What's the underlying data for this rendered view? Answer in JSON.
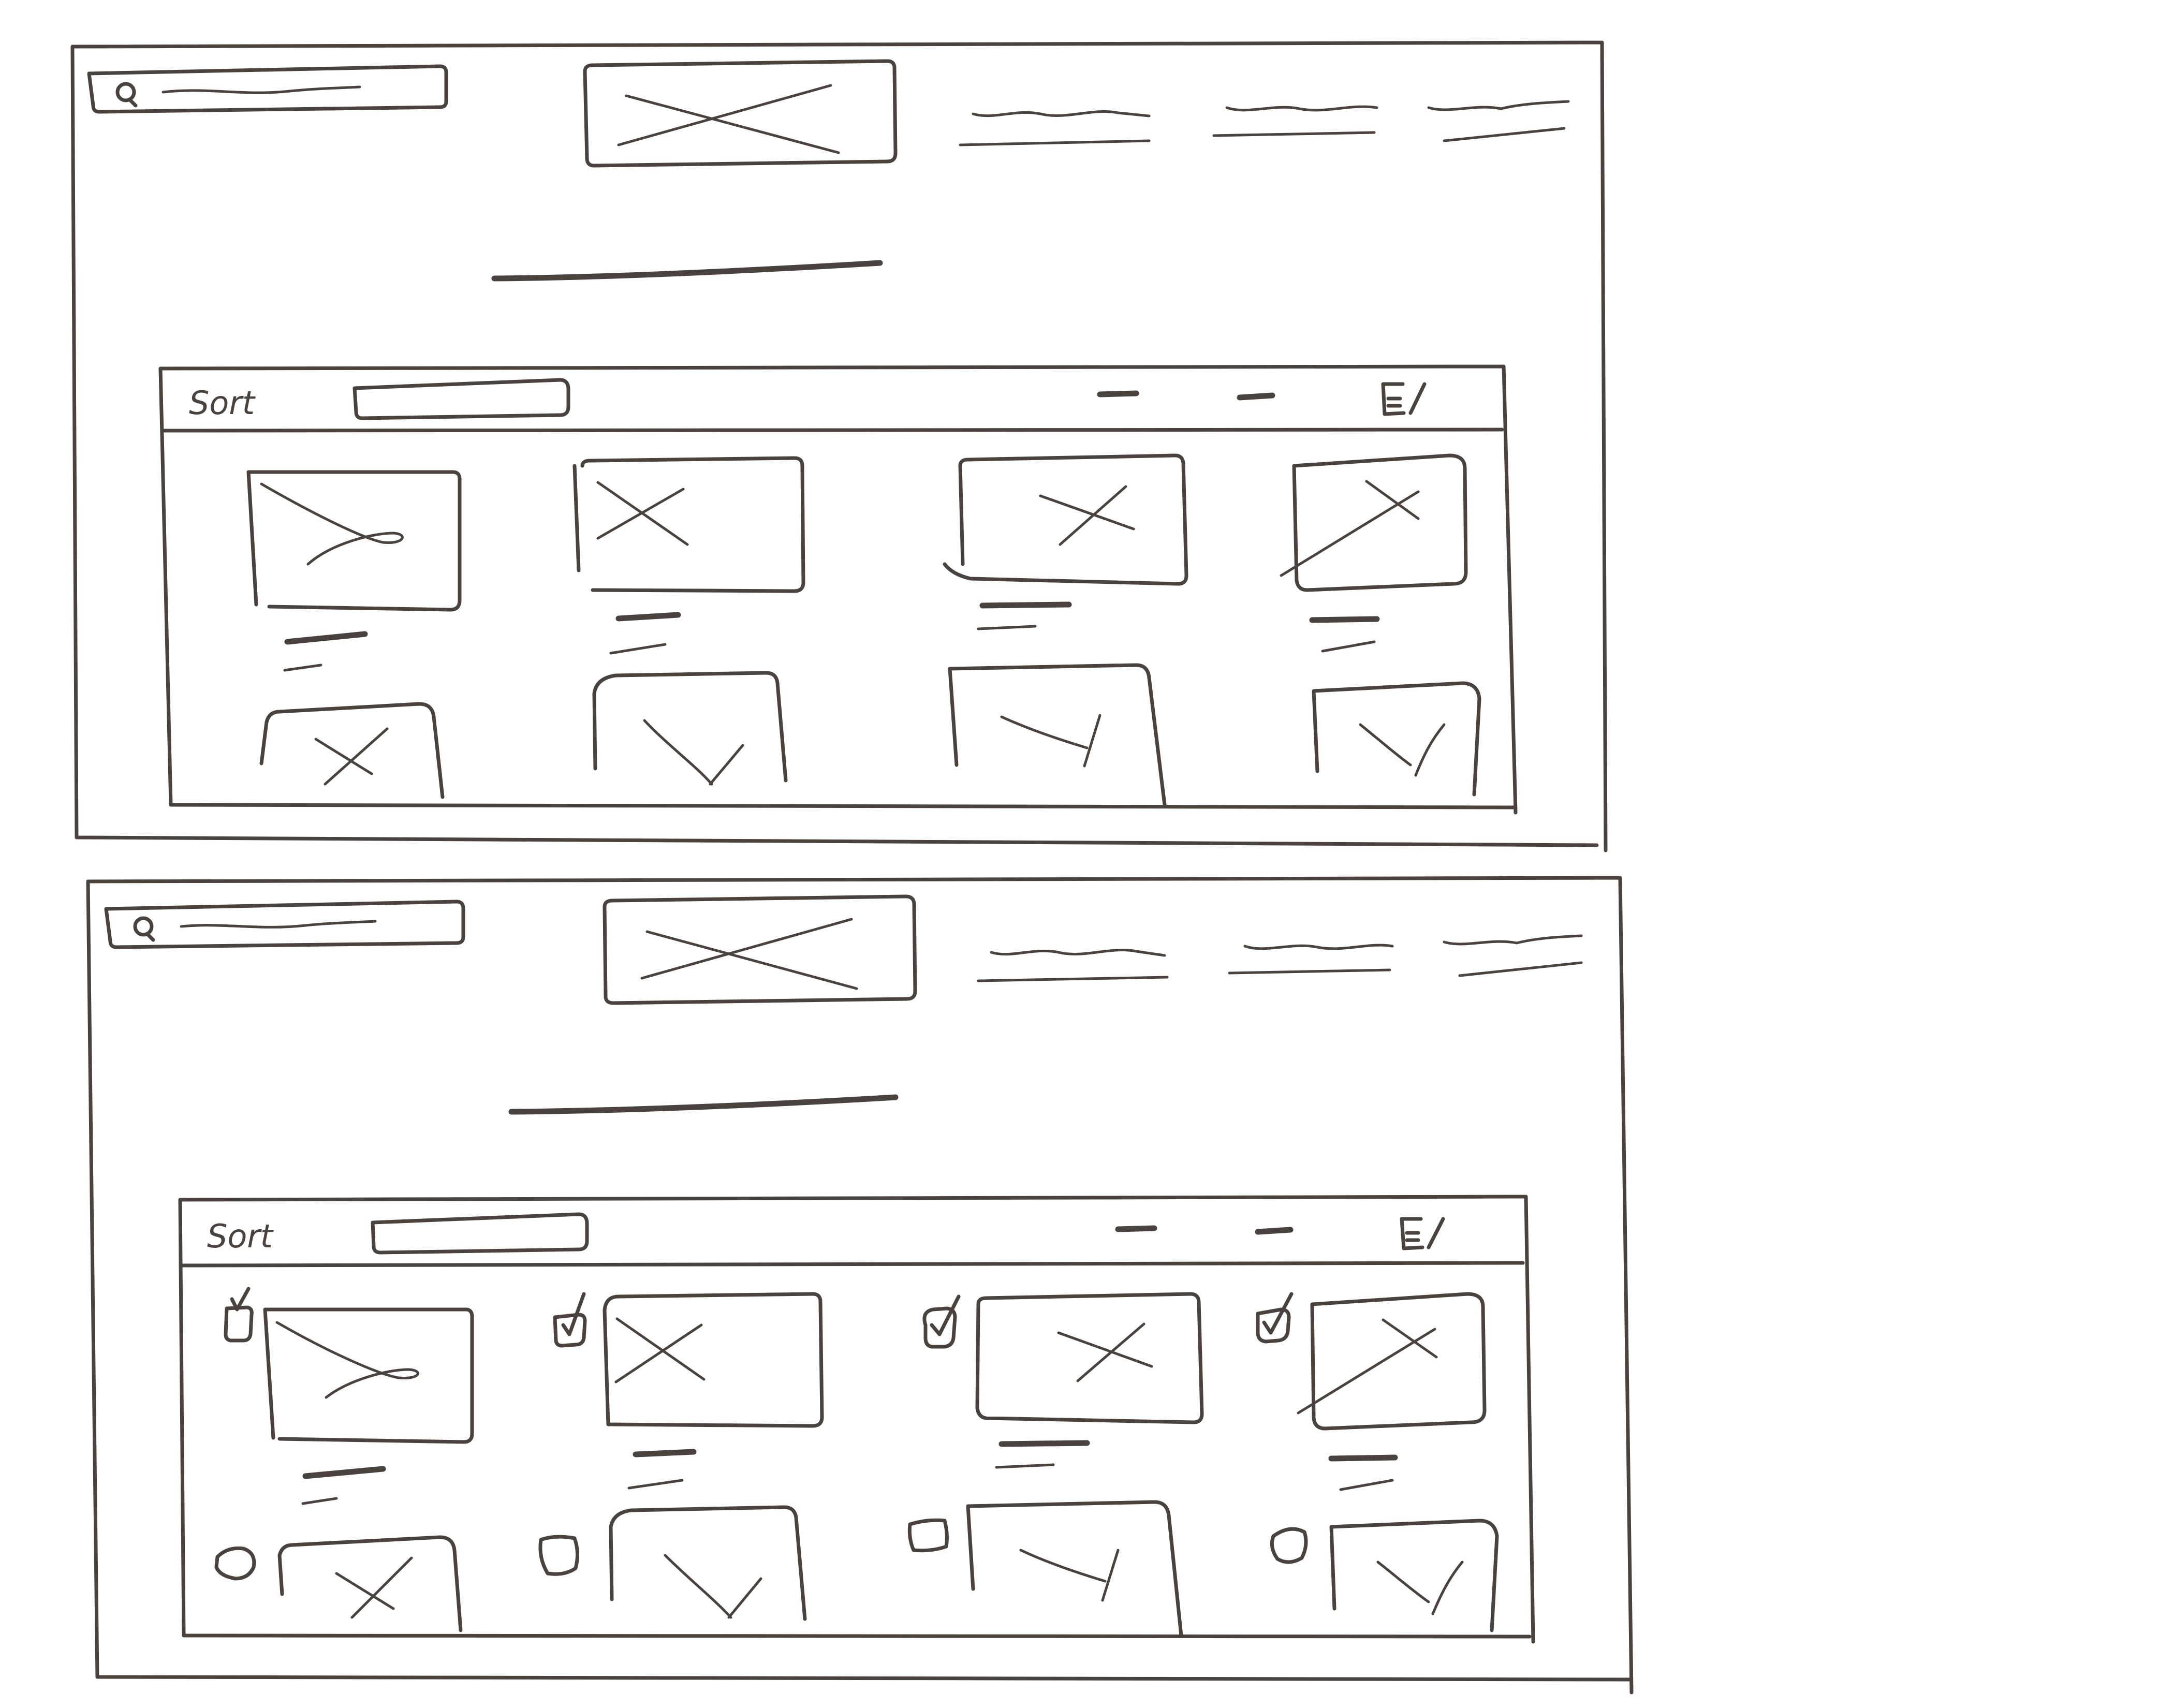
{
  "frames": [
    {
      "id": "default",
      "toolbar": {
        "sort_label": "Sort",
        "list_icon": "list-view-icon"
      },
      "selection_mode": false,
      "grid_rows": 2,
      "grid_cols": 4
    },
    {
      "id": "selection",
      "toolbar": {
        "sort_label": "Sort",
        "list_icon": "list-view-icon"
      },
      "selection_mode": true,
      "checkbox_states": [
        true,
        true,
        true,
        true,
        false,
        false,
        false,
        false
      ],
      "grid_rows": 2,
      "grid_cols": 4
    }
  ],
  "colors": {
    "ink": "#4a423e",
    "paper": "#ffffff"
  },
  "icons": {
    "search": "search-icon",
    "logo": "image-placeholder-icon",
    "list": "list-view-icon",
    "checkbox": "checkbox-icon"
  }
}
